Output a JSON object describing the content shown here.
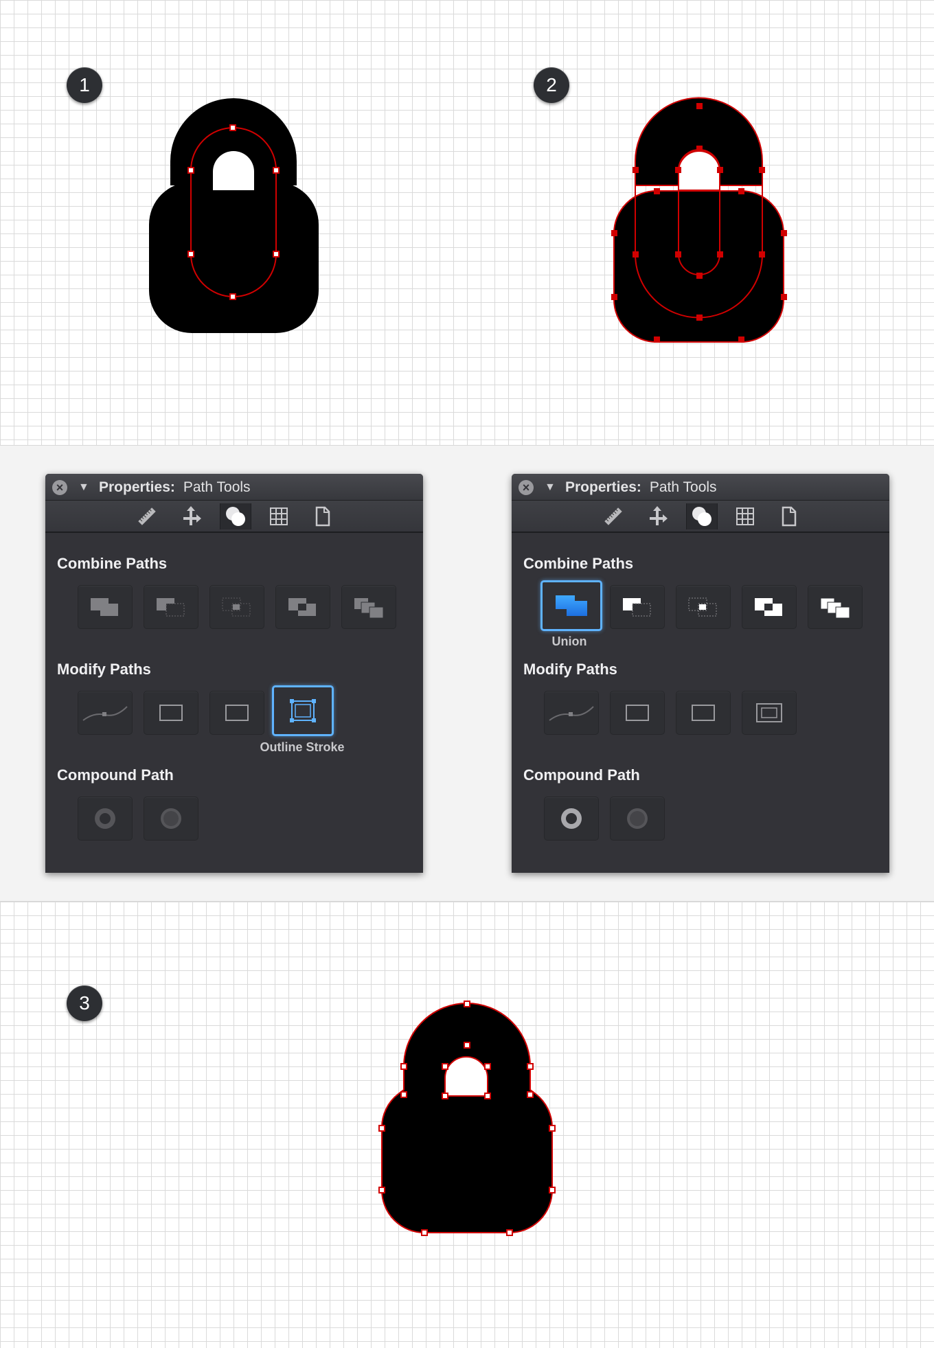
{
  "steps": {
    "one": "1",
    "two": "2",
    "three": "3"
  },
  "windows": [
    {
      "close_glyph": "×",
      "collapse_glyph": "▼",
      "title_bold": "Properties:",
      "title_rest": "Path Tools",
      "toolbar_icons": [
        "ruler-icon",
        "move-arrows-icon",
        "path-ops-icon",
        "grid-icon",
        "document-icon"
      ],
      "sections": {
        "combine": "Combine Paths",
        "modify": "Modify Paths",
        "compound": "Compound Path"
      },
      "selected_label": "Outline Stroke"
    },
    {
      "close_glyph": "×",
      "collapse_glyph": "▼",
      "title_bold": "Properties:",
      "title_rest": "Path Tools",
      "toolbar_icons": [
        "ruler-icon",
        "move-arrows-icon",
        "path-ops-icon",
        "grid-icon",
        "document-icon"
      ],
      "sections": {
        "combine": "Combine Paths",
        "modify": "Modify Paths",
        "compound": "Compound Path"
      },
      "selected_label": "Union"
    }
  ],
  "colors": {
    "path_outline": "#d10000",
    "selection_blue": "#5fb3ff",
    "window_bg": "#333338"
  }
}
